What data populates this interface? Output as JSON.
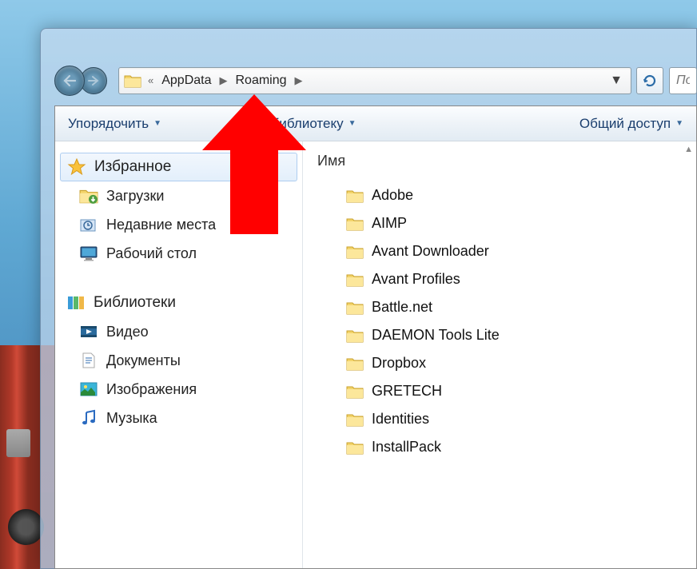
{
  "nav": {
    "breadcrumbs": [
      "AppData",
      "Roaming"
    ],
    "overflow_glyph": "«",
    "chevron_glyph": "▶",
    "dropdown_glyph": "▼"
  },
  "toolbar": {
    "organize": "Упорядочить",
    "add_library_fragment": "ить в библиотеку",
    "share": "Общий доступ"
  },
  "search": {
    "placeholder": "По"
  },
  "sidebar": {
    "favorites": {
      "header": "Избранное",
      "items": [
        "Загрузки",
        "Недавние места",
        "Рабочий стол"
      ]
    },
    "libraries": {
      "header": "Библиотеки",
      "items": [
        "Видео",
        "Документы",
        "Изображения",
        "Музыка"
      ]
    }
  },
  "columns": {
    "name": "Имя"
  },
  "files": [
    "Adobe",
    "AIMP",
    "Avant Downloader",
    "Avant Profiles",
    "Battle.net",
    "DAEMON Tools Lite",
    "Dropbox",
    "GRETECH",
    "Identities",
    "InstallPack"
  ]
}
